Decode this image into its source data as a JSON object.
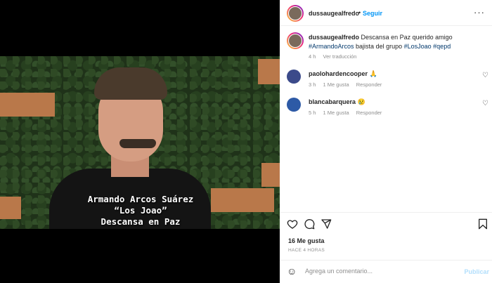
{
  "post": {
    "author": "dussaugealfredo",
    "follow_label": "Seguir",
    "caption_user": "dussaugealfredo",
    "caption_text": "Descansa en Paz querido amigo",
    "caption_tag1": "#ArmandoArcos",
    "caption_mid": "bajista del grupo",
    "caption_tag2": "#LosJoao",
    "caption_tag3": "#qepd",
    "caption_age": "4 h",
    "caption_translate": "Ver traducción",
    "media_overlay": {
      "line1": "Armando Arcos Suárez",
      "line2": "“Los Joao”",
      "line3": "Descansa en Paz"
    }
  },
  "comments": [
    {
      "user": "paolohardencooper",
      "emoji": "🙏",
      "age": "3 h",
      "likes": "1 Me gusta",
      "reply": "Responder"
    },
    {
      "user": "blancabarquera",
      "emoji": "😢",
      "age": "5 h",
      "likes": "1 Me gusta",
      "reply": "Responder"
    }
  ],
  "actions": {
    "like_icon": "heart-icon",
    "comment_icon": "comment-icon",
    "share_icon": "share-icon",
    "save_icon": "bookmark-icon"
  },
  "likes_label": "16 Me gusta",
  "timestamp": "HACE 4 HORAS",
  "composer": {
    "placeholder": "Agrega un comentario...",
    "publish_label": "Publicar"
  },
  "colors": {
    "link_blue": "#0095f6",
    "tag_blue": "#00376b",
    "muted": "#8e8e8e",
    "publish_disabled": "#b2dffc"
  }
}
